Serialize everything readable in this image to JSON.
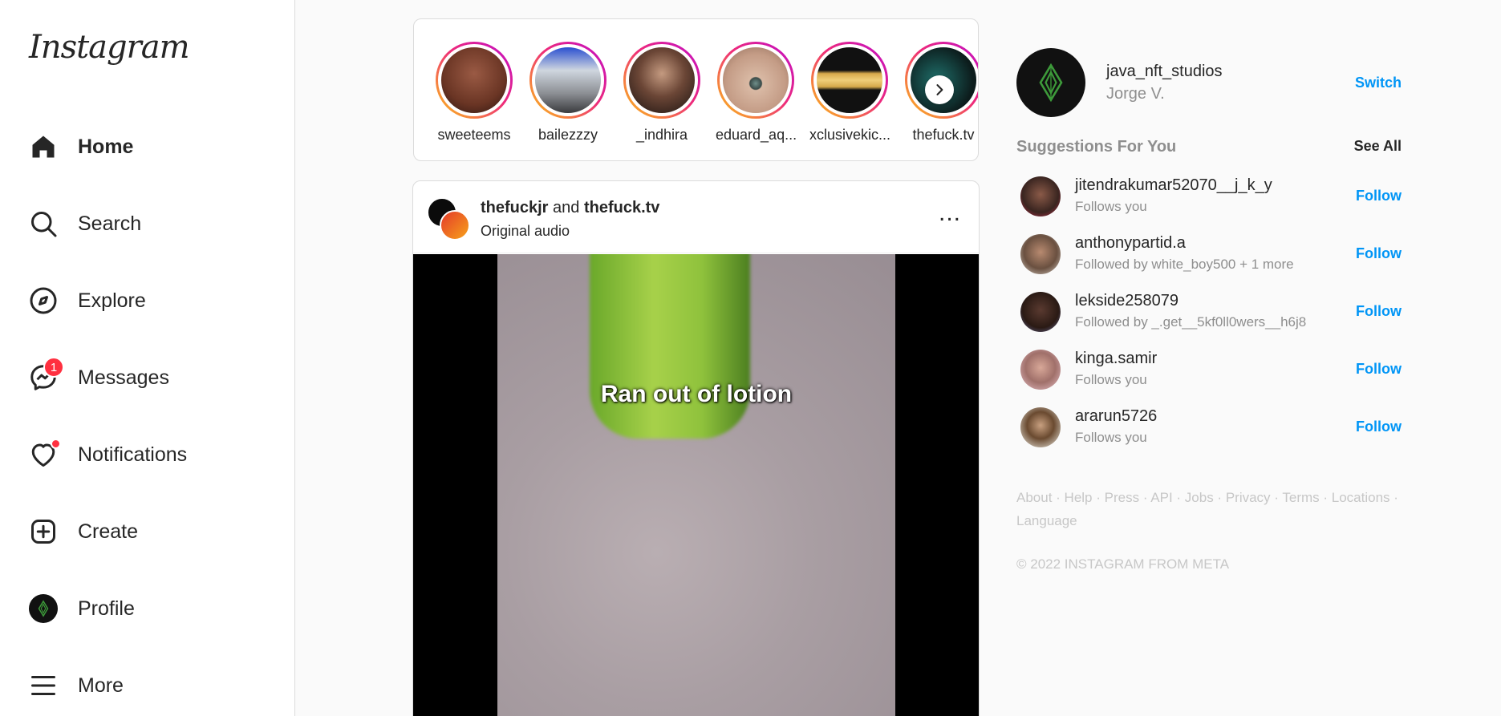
{
  "app": {
    "logo": "Instagram"
  },
  "nav": {
    "items": [
      {
        "label": "Home",
        "icon": "home-icon"
      },
      {
        "label": "Search",
        "icon": "search-icon"
      },
      {
        "label": "Explore",
        "icon": "compass-icon"
      },
      {
        "label": "Messages",
        "icon": "messenger-icon"
      },
      {
        "label": "Notifications",
        "icon": "heart-icon"
      },
      {
        "label": "Create",
        "icon": "plus-square-icon"
      },
      {
        "label": "Profile",
        "icon": "avatar"
      },
      {
        "label": "More",
        "icon": "hamburger-icon"
      }
    ],
    "messages_badge": "1"
  },
  "stories": [
    {
      "name": "sweeteems"
    },
    {
      "name": "bailezzzy"
    },
    {
      "name": "_indhira"
    },
    {
      "name": "eduard_aq..."
    },
    {
      "name": "xclusivekic..."
    },
    {
      "name": "thefuck.tv"
    }
  ],
  "post": {
    "author1": "thefuckjr",
    "joiner": "and",
    "author2": "thefuck.tv",
    "audio": "Original audio",
    "more": "...",
    "caption": "Ran out of lotion"
  },
  "me": {
    "username": "java_nft_studios",
    "name": "Jorge V.",
    "switch": "Switch"
  },
  "suggestions": {
    "title": "Suggestions For You",
    "see_all": "See All",
    "follow_label": "Follow",
    "items": [
      {
        "username": "jitendrakumar52070__j_k_y",
        "sub": "Follows you"
      },
      {
        "username": "anthonypartid.a",
        "sub": "Followed by white_boy500 + 1 more"
      },
      {
        "username": "lekside258079",
        "sub": "Followed by _.get__5kf0ll0wers__h6j8"
      },
      {
        "username": "kinga.samir",
        "sub": "Follows you"
      },
      {
        "username": "ararun5726",
        "sub": "Follows you"
      }
    ]
  },
  "footer": {
    "links": [
      "About",
      "Help",
      "Press",
      "API",
      "Jobs",
      "Privacy",
      "Terms",
      "Locations",
      "Language"
    ],
    "copyright": "© 2022 INSTAGRAM FROM META"
  }
}
